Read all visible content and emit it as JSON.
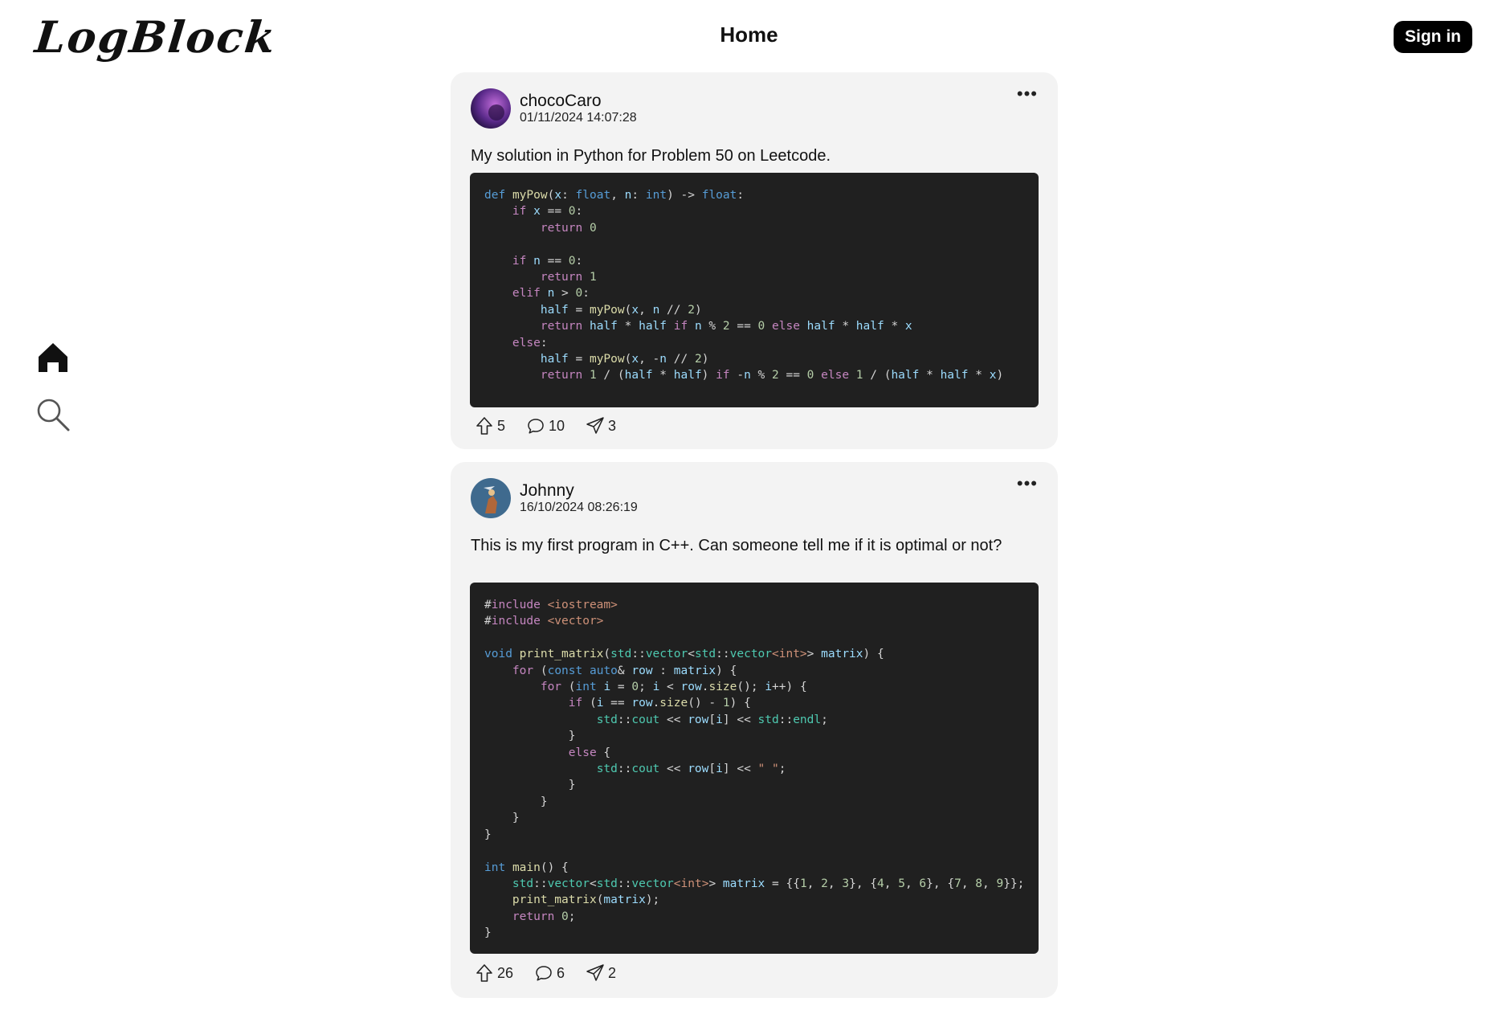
{
  "app": {
    "logo_text": "LogBlock",
    "nav_title": "Home",
    "signin_label": "Sign in"
  },
  "sidebar": {
    "items": [
      {
        "icon": "home-icon",
        "active": true
      },
      {
        "icon": "search-icon",
        "active": false
      }
    ]
  },
  "posts": [
    {
      "username": "chocoCaro",
      "timestamp": "01/11/2024 14:07:28",
      "text": "My solution in Python for Problem 50 on Leetcode.",
      "language": "Python",
      "code": "def myPow(x: float, n: int) -> float:\n    if x == 0:\n        return 0\n\n    if n == 0:\n        return 1\n    elif n > 0:\n        half = myPow(x, n // 2)\n        return half * half if n % 2 == 0 else half * half * x\n    else:\n        half = myPow(x, -n // 2)\n        return 1 / (half * half) if -n % 2 == 0 else 1 / (half * half * x)",
      "upvotes": "5",
      "comments": "10",
      "shares": "3"
    },
    {
      "username": "Johnny",
      "timestamp": "16/10/2024 08:26:19",
      "text": "This is my first program in C++. Can someone tell me if it is optimal or not?",
      "language": "C++",
      "code": "#include <iostream>\n#include <vector>\n\nvoid print_matrix(std::vector<std::vector<int>> matrix) {\n    for (const auto& row : matrix) {\n        for (int i = 0; i < row.size(); i++) {\n            if (i == row.size() - 1) {\n                std::cout << row[i] << std::endl;\n            }\n            else {\n                std::cout << row[i] << \" \";\n            }\n        }\n    }\n}\n\nint main() {\n    std::vector<std::vector<int>> matrix = {{1, 2, 3}, {4, 5, 6}, {7, 8, 9}};\n    print_matrix(matrix);\n    return 0;\n}",
      "upvotes": "26",
      "comments": "6",
      "shares": "2"
    }
  ],
  "colors": {
    "background": "#ffffff",
    "card": "#f3f3f3",
    "code_bg": "#202020",
    "signin_bg": "#000000"
  }
}
